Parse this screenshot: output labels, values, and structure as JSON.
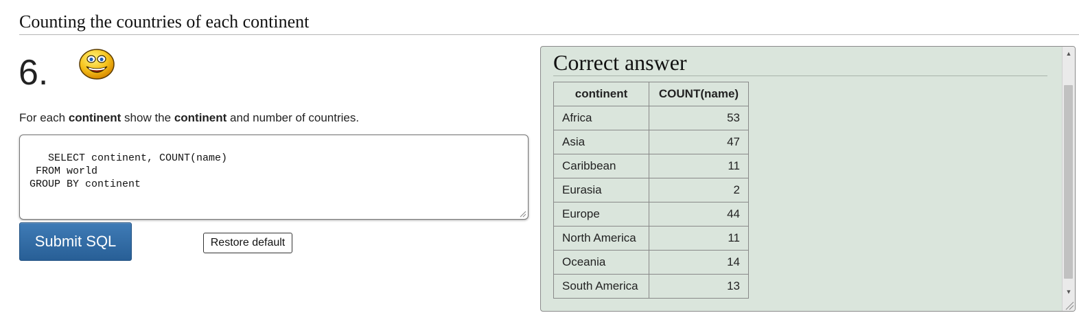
{
  "section": {
    "title": "Counting the countries of each continent"
  },
  "question": {
    "number": "6.",
    "smiley_icon": "smiley-face-icon",
    "text_parts": [
      "For each ",
      "continent",
      " show the ",
      "continent",
      " and number of countries."
    ]
  },
  "sql_editor": {
    "value": "SELECT continent, COUNT(name)\n  FROM world\n GROUP BY continent"
  },
  "buttons": {
    "submit_label": "Submit SQL",
    "restore_label": "Restore default"
  },
  "answer": {
    "title": "Correct answer",
    "columns": [
      "continent",
      "COUNT(name)"
    ],
    "rows": [
      [
        "Africa",
        "53"
      ],
      [
        "Asia",
        "47"
      ],
      [
        "Caribbean",
        "11"
      ],
      [
        "Eurasia",
        "2"
      ],
      [
        "Europe",
        "44"
      ],
      [
        "North America",
        "11"
      ],
      [
        "Oceania",
        "14"
      ],
      [
        "South America",
        "13"
      ]
    ]
  },
  "colors": {
    "answer_background": "#dae5dc",
    "submit_button": "#2f6aa6"
  }
}
